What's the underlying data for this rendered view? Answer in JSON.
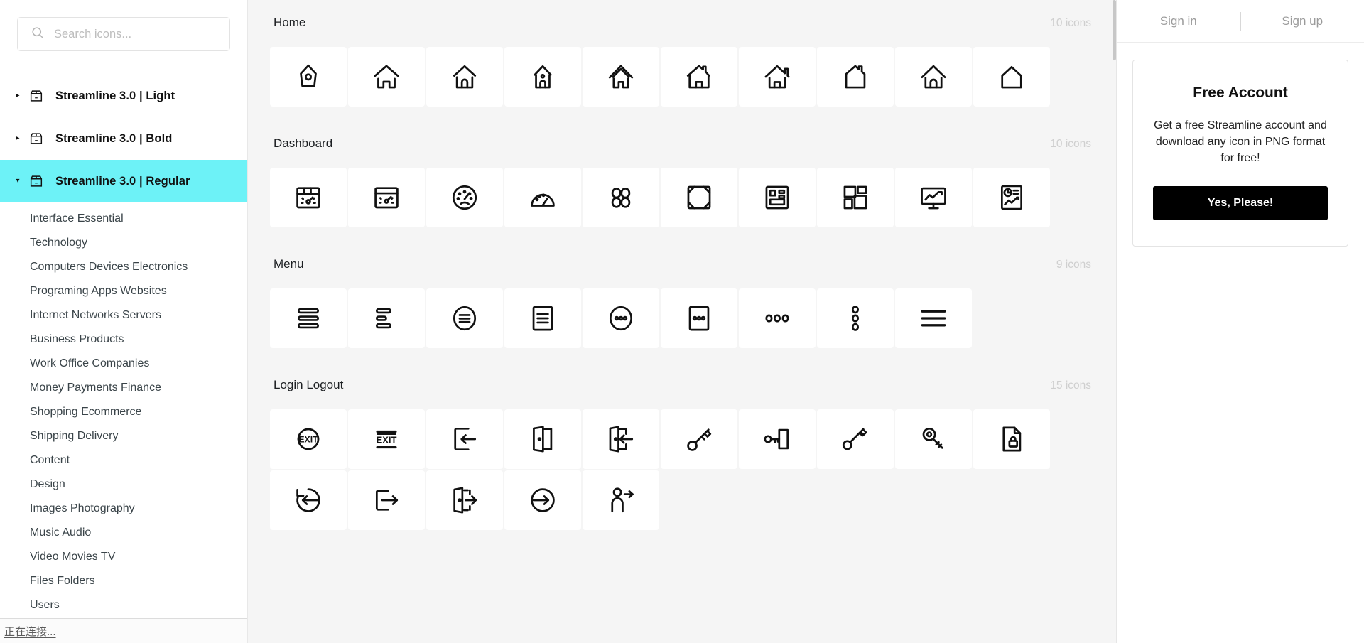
{
  "sidebar": {
    "search": {
      "placeholder": "Search icons...",
      "value": "",
      "icon": "search-icon"
    },
    "packs": [
      {
        "label": "Streamline 3.0 | Light",
        "expanded": false,
        "caret": "▸",
        "icon": "package-icon"
      },
      {
        "label": "Streamline 3.0 | Bold",
        "expanded": false,
        "caret": "▸",
        "icon": "package-icon"
      },
      {
        "label": "Streamline 3.0 | Regular",
        "expanded": true,
        "caret": "▾",
        "icon": "package-icon"
      }
    ],
    "active_pack_index": 2,
    "active_pack_color": "#6df2f7",
    "categories": [
      "Interface Essential",
      "Technology",
      "Computers Devices Electronics",
      "Programing Apps Websites",
      "Internet Networks Servers",
      "Business Products",
      "Work Office Companies",
      "Money Payments Finance",
      "Shopping Ecommerce",
      "Shipping Delivery",
      "Content",
      "Design",
      "Images Photography",
      "Music Audio",
      "Video Movies TV",
      "Files Folders",
      "Users"
    ],
    "status": "正在连接..."
  },
  "main": {
    "sections": [
      {
        "title": "Home",
        "count": "10 icons",
        "icons": [
          "birdhouse-icon",
          "house-icon",
          "house-door-icon",
          "house-chimney-door-icon",
          "house-roof-icon",
          "house-chimney-icon",
          "house-chimney-tall-icon",
          "house-outline-icon",
          "house-arch-icon",
          "house-plain-icon"
        ]
      },
      {
        "title": "Dashboard",
        "count": "10 icons",
        "icons": [
          "dashboard-browser-icon",
          "dashboard-window-icon",
          "gauge-circle-icon",
          "gauge-dial-icon",
          "dashboard-four-circles-icon",
          "dashboard-frame-icon",
          "dashboard-blocks-icon",
          "dashboard-layout-icon",
          "dashboard-monitor-chart-icon",
          "dashboard-report-icon"
        ]
      },
      {
        "title": "Menu",
        "count": "9 icons",
        "icons": [
          "menu-bars-icon",
          "menu-align-left-icon",
          "menu-circle-icon",
          "menu-document-icon",
          "menu-dots-circle-icon",
          "menu-dots-square-icon",
          "menu-dots-horizontal-icon",
          "menu-dots-vertical-icon",
          "menu-hamburger-icon"
        ]
      },
      {
        "title": "Login Logout",
        "count": "15 icons",
        "icons": [
          "exit-arch-icon",
          "exit-sign-icon",
          "login-arrow-in-icon",
          "door-open-icon",
          "door-exit-arrow-icon",
          "key-icon",
          "key-door-icon",
          "key-alt-icon",
          "key-ring-icon",
          "file-lock-icon",
          "logout-circle-left-icon",
          "logout-arrow-right-icon",
          "door-arrow-out-icon",
          "login-circle-right-icon",
          "user-arrow-icon"
        ]
      }
    ]
  },
  "rightpanel": {
    "tabs": [
      {
        "label": "Sign in"
      },
      {
        "label": "Sign up"
      }
    ],
    "card": {
      "title": "Free Account",
      "description": "Get a free Streamline account and download any icon in PNG format for free!",
      "button": "Yes, Please!",
      "button_color": "#000000"
    }
  }
}
